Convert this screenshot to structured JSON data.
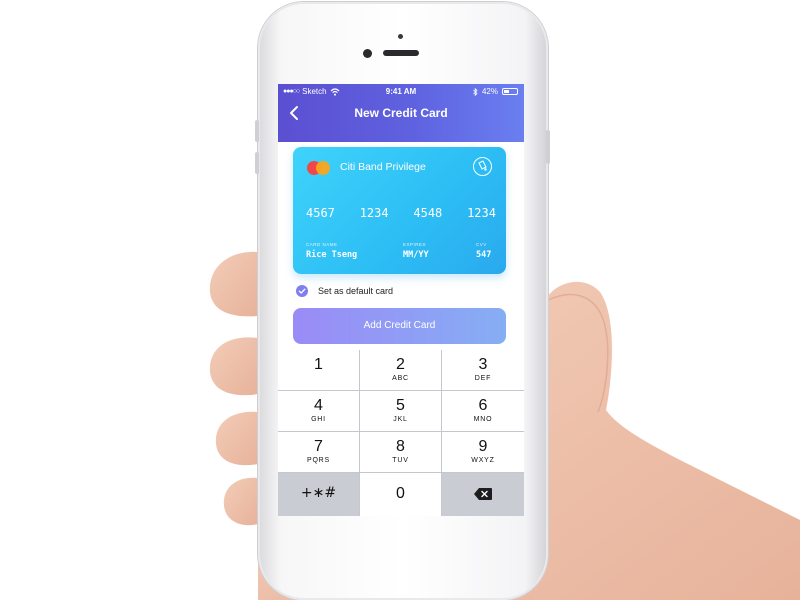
{
  "status_bar": {
    "carrier": "Sketch",
    "signal_dots": "●●●○○",
    "time": "9:41 AM",
    "battery": "42%"
  },
  "nav": {
    "title": "New Credit Card",
    "back_icon": "chevron-left-icon"
  },
  "card": {
    "bank": "Citi Band Privilege",
    "brand_icon": "mastercard-logo",
    "number_groups": [
      "4567",
      "1234",
      "4548",
      "1234"
    ],
    "name_label": "CARD NAME",
    "name_value": "Rice Tseng",
    "expires_label": "EXPIRES",
    "expires_value": "MM/YY",
    "cvv_label": "CVV",
    "cvv_value": "547",
    "colors": {
      "start": "#3fd3fb",
      "end": "#2aa9ee"
    }
  },
  "default_card": {
    "label": "Set as default card",
    "checked": true
  },
  "add_button": {
    "label": "Add Credit Card"
  },
  "keypad": {
    "keys": [
      {
        "num": "1",
        "letters": ""
      },
      {
        "num": "2",
        "letters": "ABC"
      },
      {
        "num": "3",
        "letters": "DEF"
      },
      {
        "num": "4",
        "letters": "GHI"
      },
      {
        "num": "5",
        "letters": "JKL"
      },
      {
        "num": "6",
        "letters": "MNO"
      },
      {
        "num": "7",
        "letters": "PQRS"
      },
      {
        "num": "8",
        "letters": "TUV"
      },
      {
        "num": "9",
        "letters": "WXYZ"
      }
    ],
    "symbols": "+∗#",
    "zero": "0",
    "delete_icon": "backspace-icon"
  },
  "theme": {
    "header_start": "#5b4fd1",
    "header_end": "#6a7ff0",
    "accent": "#7e7ef0"
  }
}
